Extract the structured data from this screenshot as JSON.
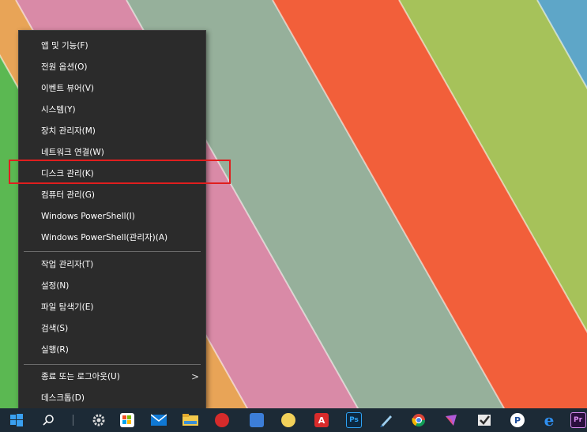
{
  "menu": {
    "items": [
      {
        "label": "앱 및 기능(F)"
      },
      {
        "label": "전원 옵션(O)"
      },
      {
        "label": "이벤트 뷰어(V)"
      },
      {
        "label": "시스템(Y)"
      },
      {
        "label": "장치 관리자(M)"
      },
      {
        "label": "네트워크 연결(W)"
      },
      {
        "label": "디스크 관리(K)"
      },
      {
        "label": "컴퓨터 관리(G)"
      },
      {
        "label": "Windows PowerShell(I)"
      },
      {
        "label": "Windows PowerShell(관리자)(A)"
      },
      {
        "label": "작업 관리자(T)"
      },
      {
        "label": "설정(N)"
      },
      {
        "label": "파일 탐색기(E)"
      },
      {
        "label": "검색(S)"
      },
      {
        "label": "실행(R)"
      },
      {
        "label": "종료 또는 로그아웃(U)"
      },
      {
        "label": "데스크톱(D)"
      }
    ],
    "submenu_arrow": ">"
  },
  "taskbar": {
    "icons": [
      {
        "name": "start-icon",
        "glyph": ""
      },
      {
        "name": "search-icon",
        "glyph": ""
      },
      {
        "name": "settings-gear-icon",
        "glyph": ""
      },
      {
        "name": "store-icon",
        "glyph": ""
      },
      {
        "name": "mail-icon",
        "glyph": ""
      },
      {
        "name": "file-explorer-icon",
        "glyph": ""
      },
      {
        "name": "red-app-icon",
        "glyph": ""
      },
      {
        "name": "blue-app-icon",
        "glyph": ""
      },
      {
        "name": "mascot-app-icon",
        "glyph": ""
      },
      {
        "name": "acrobat-icon",
        "glyph": "A"
      },
      {
        "name": "photoshop-icon",
        "glyph": "Ps"
      },
      {
        "name": "pen-app-icon",
        "glyph": ""
      },
      {
        "name": "chrome-icon",
        "glyph": ""
      },
      {
        "name": "colorful-app-icon",
        "glyph": ""
      },
      {
        "name": "checkmark-app-icon",
        "glyph": ""
      },
      {
        "name": "p-app-icon",
        "glyph": "P"
      },
      {
        "name": "edge-icon",
        "glyph": "e"
      },
      {
        "name": "premiere-icon",
        "glyph": "Pr"
      }
    ]
  },
  "colors": {
    "menu_bg": "#2b2b2b",
    "highlight_border": "#e01e1e",
    "taskbar_bg": "#1c2a36"
  }
}
